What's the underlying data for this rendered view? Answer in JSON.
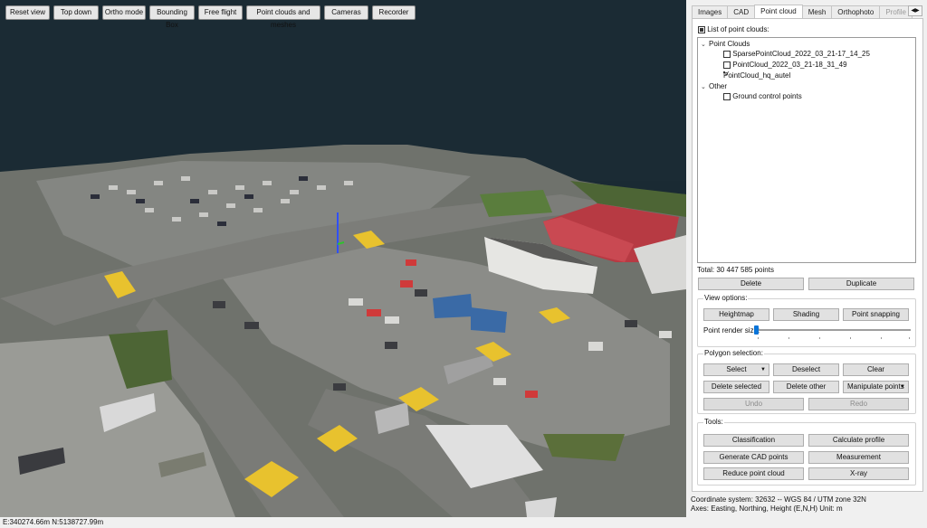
{
  "viewport": {
    "toolbar": [
      {
        "id": "reset-view",
        "label": "Reset view"
      },
      {
        "id": "top-down",
        "label": "Top down"
      },
      {
        "id": "ortho-mode",
        "label": "Ortho mode"
      },
      {
        "id": "bounding-box",
        "label": "Bounding Box"
      },
      {
        "id": "free-flight",
        "label": "Free flight"
      },
      {
        "id": "point-clouds-and-meshes",
        "label": "Point clouds and meshes"
      },
      {
        "id": "cameras",
        "label": "Cameras"
      },
      {
        "id": "recorder",
        "label": "Recorder"
      }
    ]
  },
  "tabs": [
    {
      "label": "Images",
      "active": false
    },
    {
      "label": "CAD",
      "active": false
    },
    {
      "label": "Point cloud",
      "active": true
    },
    {
      "label": "Mesh",
      "active": false
    },
    {
      "label": "Orthophoto",
      "active": false
    },
    {
      "label": "Profile",
      "active": false,
      "disabled": true
    }
  ],
  "tab_scroll_icon": "tab-scroll-arrows-icon",
  "point_cloud": {
    "list_label": "List of point clouds:",
    "list_checked": true,
    "tree": {
      "group1": {
        "label": "Point Clouds",
        "items": [
          {
            "label": "SparsePointCloud_2022_03_21-17_14_25",
            "checked": false
          },
          {
            "label": "PointCloud_2022_03_21-18_31_49",
            "checked": false
          },
          {
            "label": "PointCloud_hq_autel",
            "checked": true
          }
        ]
      },
      "group2": {
        "label": "Other",
        "items": [
          {
            "label": "Ground control points",
            "checked": false
          }
        ]
      }
    },
    "total": "Total: 30 447 585 points",
    "delete_label": "Delete",
    "duplicate_label": "Duplicate",
    "view_options": {
      "title": "View options:",
      "heightmap": "Heightmap",
      "shading": "Shading",
      "point_snapping": "Point snapping",
      "render_size_label": "Point render size:",
      "render_size_level": 0.0
    },
    "polygon": {
      "title": "Polygon selection:",
      "select": "Select",
      "deselect": "Deselect",
      "clear": "Clear",
      "delete_selected": "Delete selected",
      "delete_other": "Delete other",
      "manipulate_points": "Manipulate points",
      "undo": "Undo",
      "redo": "Redo"
    },
    "tools": {
      "title": "Tools:",
      "classification": "Classification",
      "calculate_profile": "Calculate profile",
      "generate_cad_points": "Generate CAD points",
      "measurement": "Measurement",
      "reduce_point_cloud": "Reduce point cloud",
      "x_ray": "X-ray"
    }
  },
  "coordinate_system": "Coordinate system: 32632 -- WGS 84 / UTM zone 32N",
  "axes_info": "Axes: Easting, Northing, Height (E,N,H) Unit: m",
  "status": "E:340274.66m N:5138727.99m",
  "colors": {
    "water": "#1a2a33",
    "asphalt": "#8d8d8a",
    "road_marking_yellow": "#e8c22e",
    "roof_red": "#c8323c",
    "accent_blue": "#0a74d8"
  }
}
